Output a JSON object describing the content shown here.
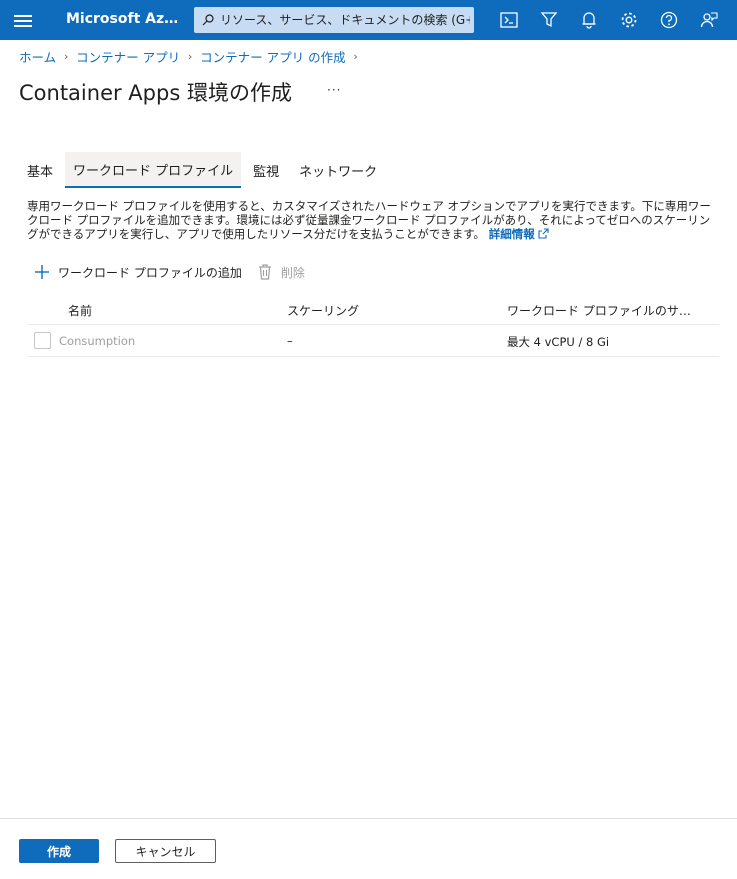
{
  "topbar": {
    "brand": "Microsoft Az…",
    "search_placeholder": "リソース、サービス、ドキュメントの検索 (G+/)",
    "icons": [
      "menu-icon",
      "search-icon",
      "cloud-shell-icon",
      "directory-filter-icon",
      "notifications-icon",
      "settings-icon",
      "help-icon",
      "feedback-icon"
    ]
  },
  "breadcrumb": [
    "ホーム",
    "コンテナー アプリ",
    "コンテナー アプリ の作成"
  ],
  "page": {
    "title": "Container Apps 環境の作成",
    "more": "···"
  },
  "tabs": [
    {
      "label": "基本",
      "active": false
    },
    {
      "label": "ワークロード プロファイル",
      "active": true
    },
    {
      "label": "監視",
      "active": false
    },
    {
      "label": "ネットワーク",
      "active": false
    }
  ],
  "description": {
    "text": "専用ワークロード プロファイルを使用すると、カスタマイズされたハードウェア オプションでアプリを実行できます。下に専用ワークロード プロファイルを追加できます。環境には必ず従量課金ワークロード プロファイルがあり、それによってゼロへのスケーリングができるアプリを実行し、アプリで使用したリソース分だけを支払うことができます。",
    "link": "詳細情報"
  },
  "toolbar": {
    "add_label": "ワークロード プロファイルの追加",
    "delete_label": "削除"
  },
  "grid": {
    "columns": [
      "名前",
      "スケーリング",
      "ワークロード プロファイルのサ…"
    ],
    "rows": [
      {
        "name": "Consumption",
        "scaling": "–",
        "size": "最大 4 vCPU / 8 Gi"
      }
    ]
  },
  "footer": {
    "create_label": "作成",
    "cancel_label": "キャンセル"
  },
  "colors": {
    "accent": "#0f6cbd",
    "search_bg": "#c7dcf2"
  }
}
